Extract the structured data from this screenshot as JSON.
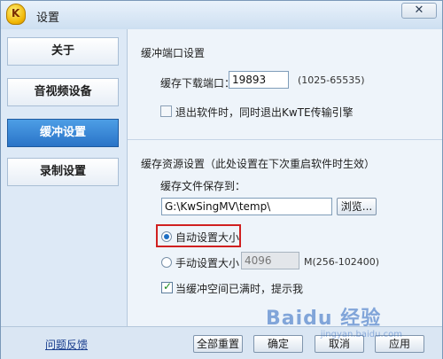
{
  "window": {
    "title": "设置",
    "close_label": "✕"
  },
  "sidebar": {
    "items": [
      {
        "label": "关于"
      },
      {
        "label": "音视频设备"
      },
      {
        "label": "缓冲设置"
      },
      {
        "label": "录制设置"
      }
    ]
  },
  "port_section": {
    "title": "缓冲端口设置",
    "port_label": "缓存下载端口：",
    "port_value": "19893",
    "port_range": "(1025-65535)",
    "exit_checkbox_label": "退出软件时，同时退出KwTE传输引擎",
    "exit_checked": false
  },
  "cache_section": {
    "title": "缓存资源设置（此处设置在下次重启软件时生效）",
    "save_to_label": "缓存文件保存到：",
    "path_value": "G:\\KwSingMV\\temp\\",
    "browse_label": "浏览...",
    "auto_size_label": "自动设置大小",
    "auto_selected": true,
    "manual_size_label": "手动设置大小",
    "manual_value": "4096",
    "manual_range": "M(256-102400)",
    "notify_label": "当缓冲空间已满时，提示我",
    "notify_checked": true
  },
  "footer": {
    "feedback_label": "问题反馈",
    "reset_label": "全部重置",
    "ok_label": "确定",
    "cancel_label": "取消",
    "apply_label": "应用"
  },
  "watermark": {
    "text": "Baidu 经验",
    "sub": "jingyan.baidu.com"
  },
  "colors": {
    "accent": "#2a74c7",
    "highlight": "#d02020"
  }
}
